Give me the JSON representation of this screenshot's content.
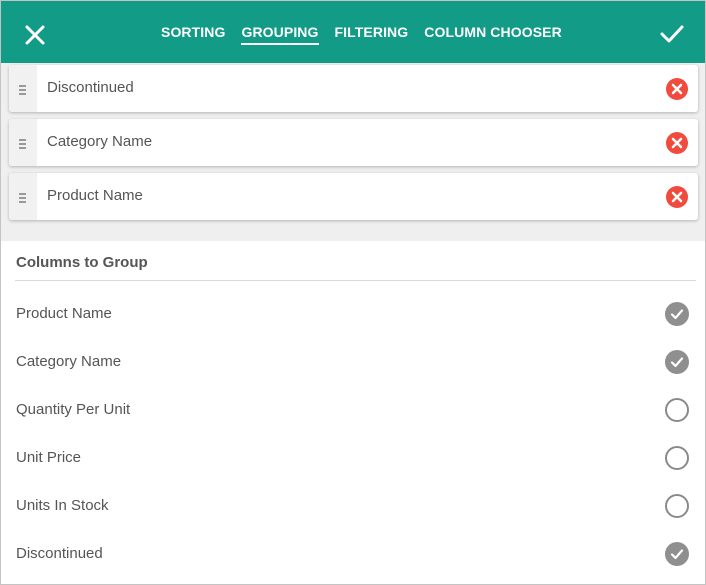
{
  "header": {
    "tabs": [
      {
        "label": "SORTING",
        "active": false
      },
      {
        "label": "GROUPING",
        "active": true
      },
      {
        "label": "FILTERING",
        "active": false
      },
      {
        "label": "COLUMN CHOOSER",
        "active": false
      }
    ],
    "close_icon": "close-icon",
    "confirm_icon": "check-icon"
  },
  "grouped_columns": [
    {
      "label": "Discontinued"
    },
    {
      "label": "Category Name"
    },
    {
      "label": "Product Name"
    }
  ],
  "columns_section": {
    "title": "Columns to Group",
    "items": [
      {
        "label": "Product Name",
        "checked": true
      },
      {
        "label": "Category Name",
        "checked": true
      },
      {
        "label": "Quantity Per Unit",
        "checked": false
      },
      {
        "label": "Unit Price",
        "checked": false
      },
      {
        "label": "Units In Stock",
        "checked": false
      },
      {
        "label": "Discontinued",
        "checked": true
      }
    ]
  },
  "colors": {
    "header_bg": "#129b86",
    "remove_red": "#f04c3e",
    "check_grey": "#8f8f8f",
    "area_bg": "#efefef"
  }
}
